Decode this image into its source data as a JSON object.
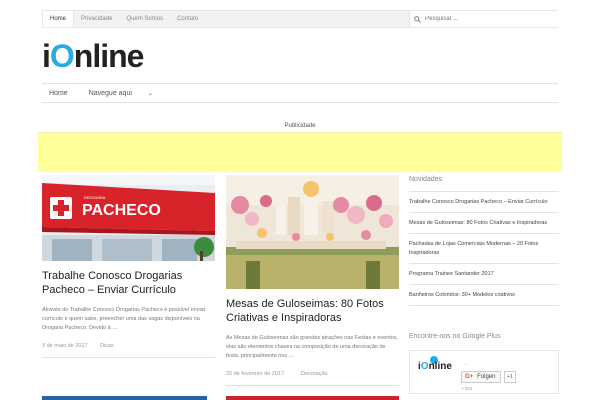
{
  "topnav": {
    "items": [
      "Home",
      "Privacidade",
      "Quem Somos",
      "Contato"
    ]
  },
  "search": {
    "placeholder": "Pesquisar ..."
  },
  "logo": {
    "prefix": "i",
    "o": "O",
    "suffix": "nline"
  },
  "mainnav": {
    "home": "Home",
    "navegue": "Navegue aqui"
  },
  "ad": {
    "label": "Publicidade"
  },
  "posts": [
    {
      "title": "Trabalhe Conosco Drogarias Pacheco – Enviar Currículo",
      "excerpt": "Através do Trabalhe Conosco Drogarias Pacheco é possível enviar currículo e quem sabe, preencher uma das vagas disponíveis na Drogaria Pacheco. Devido à ...",
      "date": "3 de maio de 2017",
      "category": "Dicas",
      "sign_brand": "DROGARIA",
      "sign_name": "PACHECO"
    },
    {
      "title": "Mesas de Guloseimas: 80 Fotos Criativas e Inspiradoras",
      "excerpt": "As Mesas de Guloseimas são grandes atrações nas Festas e eventos, elas são elementos chaves na composição de uma decoração de festa, principalmente nos ...",
      "date": "22 de fevereiro de 2017",
      "category": "Decoração"
    }
  ],
  "sidebar": {
    "title": "Novidades",
    "items": [
      "Trabalhe Conosco Drogarias Pacheco – Enviar Currículo",
      "Mesas de Guloseimas: 80 Fotos Criativas e Inspiradoras",
      "Pachadas de Lojas Comerciais Modernas – 20 Fotos Inspiradoras",
      "Programa Trainee Santander 2017",
      "Banheiros Coloridos: 30+ Modelos criativos"
    ]
  },
  "googleplus": {
    "title": "Encontre-nos no Google Plus",
    "logo_prefix": "i",
    "logo_o": "O",
    "logo_suffix": "nline",
    "dots": "...",
    "follow_icon": "G+",
    "follow_label": "Folgen",
    "count": "+1",
    "followers": "+ 331"
  },
  "colors": {
    "accent": "#2ba9e1",
    "ad_bg": "#ffff99",
    "pacheco_red": "#d8232a"
  }
}
